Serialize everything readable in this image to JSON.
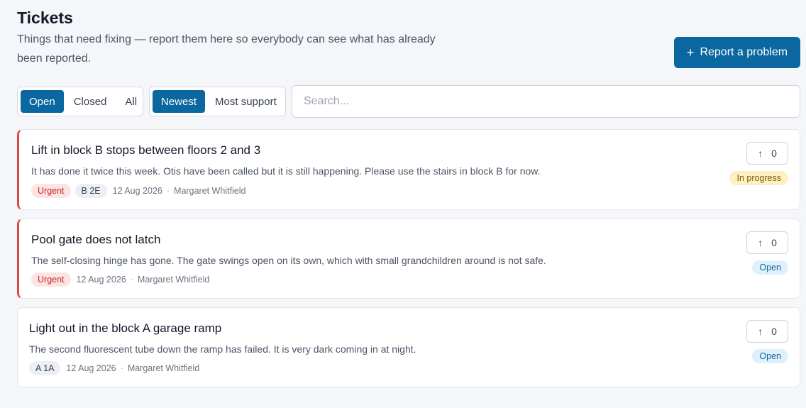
{
  "header": {
    "title": "Tickets",
    "subtitle": "Things that need fixing — report them here so everybody can see what has already been reported.",
    "report_button": {
      "icon": "plus-icon",
      "label": "Report a problem"
    }
  },
  "filters": {
    "status": [
      {
        "label": "Open",
        "active": true
      },
      {
        "label": "Closed",
        "active": false
      },
      {
        "label": "All",
        "active": false
      }
    ],
    "sort": [
      {
        "label": "Newest",
        "active": true
      },
      {
        "label": "Most support",
        "active": false
      }
    ],
    "search": {
      "placeholder": "Search...",
      "value": ""
    }
  },
  "tickets": [
    {
      "title": "Lift in block B stops between floors 2 and 3",
      "body": "It has done it twice this week. Otis have been called but it is still happening. Please use the stairs in block B for now.",
      "urgent": true,
      "urgent_label": "Urgent",
      "unit": "B 2E",
      "date": "12 Aug 2026",
      "separator": "·",
      "author": "Margaret Whitfield",
      "votes": "0",
      "status": "In progress"
    },
    {
      "title": "Pool gate does not latch",
      "body": "The self-closing hinge has gone. The gate swings open on its own, which with small grandchildren around is not safe.",
      "urgent": true,
      "urgent_label": "Urgent",
      "unit": "",
      "date": "12 Aug 2026",
      "separator": "·",
      "author": "Margaret Whitfield",
      "votes": "0",
      "status": "Open"
    },
    {
      "title": "Light out in the block A garage ramp",
      "body": "The second fluorescent tube down the ramp has failed. It is very dark coming in at night.",
      "urgent": false,
      "urgent_label": "",
      "unit": "A 1A",
      "date": "12 Aug 2026",
      "separator": "·",
      "author": "Margaret Whitfield",
      "votes": "0",
      "status": "Open"
    }
  ],
  "colors": {
    "accent": "#0b679f",
    "urgent": "#e04646",
    "background": "#f4f6f9"
  }
}
